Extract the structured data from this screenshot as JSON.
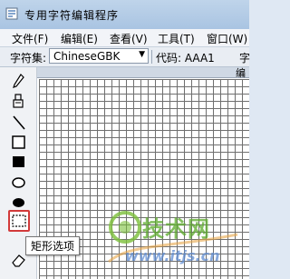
{
  "window": {
    "title": "专用字符编辑程序"
  },
  "menu": [
    "文件(F)",
    "编辑(E)",
    "查看(V)",
    "工具(T)",
    "窗口(W)"
  ],
  "toolbar": {
    "charset_label": "字符集:",
    "charset_value": "ChineseGBK",
    "code_label": "代码: AAA1",
    "trailing_label": "字"
  },
  "canvas": {
    "header_char": "编"
  },
  "tools": [
    {
      "name": "pencil-tool",
      "icon": "pencil-icon"
    },
    {
      "name": "fill-tool",
      "icon": "bucket-icon"
    },
    {
      "name": "line-tool",
      "icon": "line-icon"
    },
    {
      "name": "hollow-rect-tool",
      "icon": "rectangle-outline-icon"
    },
    {
      "name": "filled-rect-tool",
      "icon": "rectangle-filled-icon"
    },
    {
      "name": "hollow-ellipse-tool",
      "icon": "ellipse-outline-icon"
    },
    {
      "name": "filled-ellipse-tool",
      "icon": "ellipse-filled-icon"
    },
    {
      "name": "rect-select-tool",
      "icon": "rect-select-icon",
      "selected": true
    },
    {
      "name": "eraser-tool",
      "icon": "eraser-icon"
    }
  ],
  "tooltip": {
    "text": "矩形选项"
  },
  "watermark": {
    "brand": "技术网",
    "url": "www.itjs.cn"
  }
}
